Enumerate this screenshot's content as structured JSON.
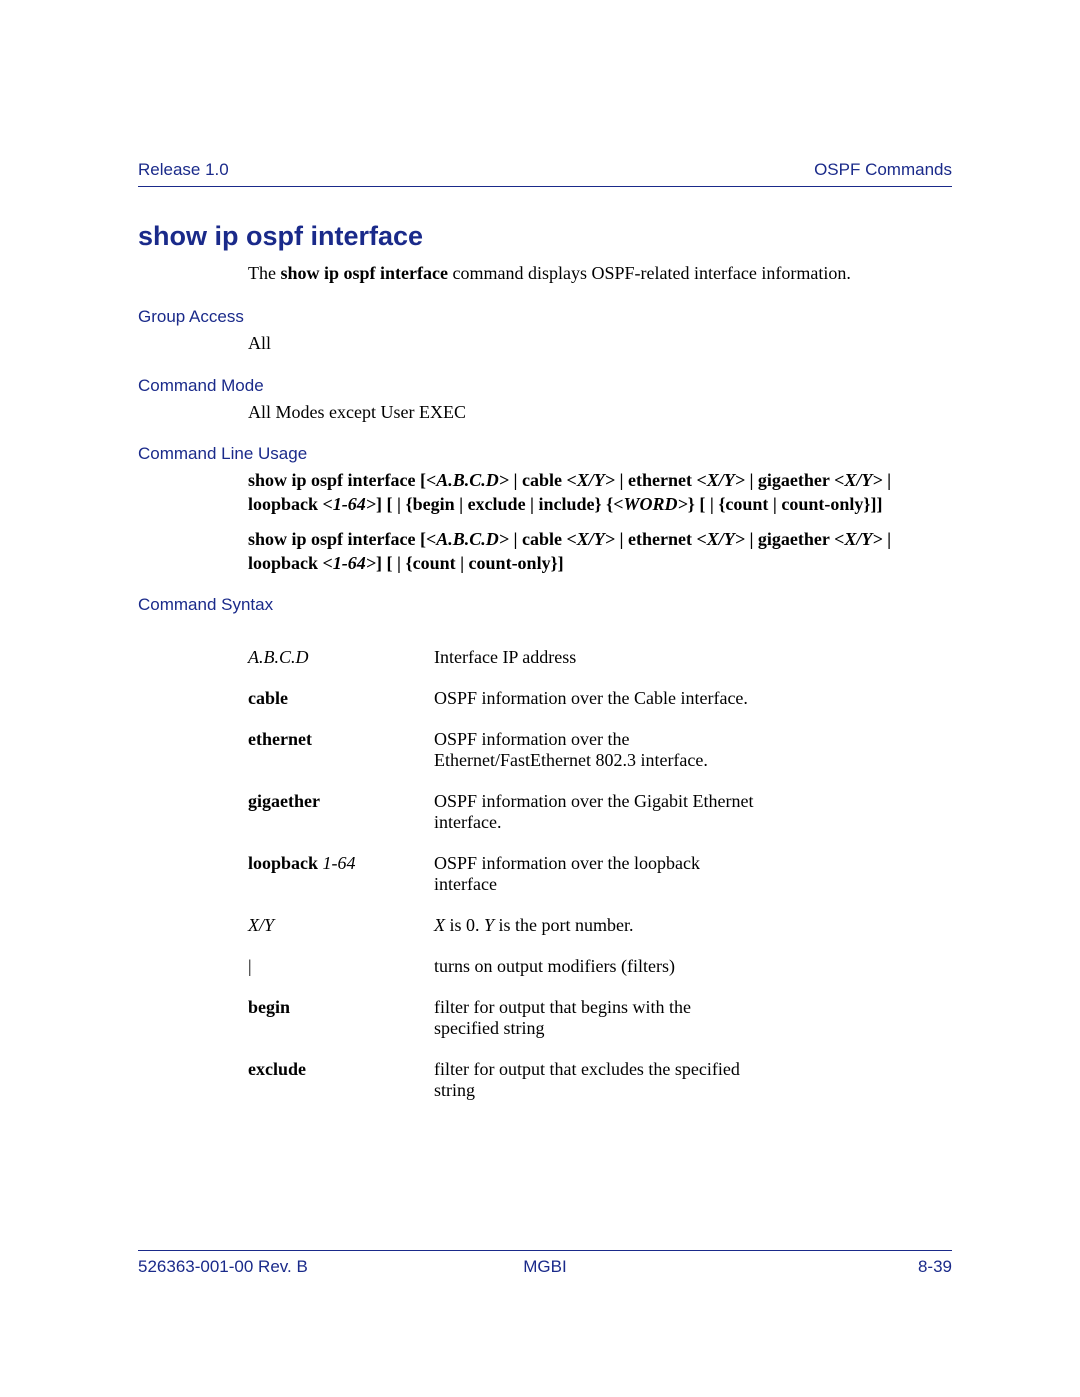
{
  "header": {
    "left": "Release 1.0",
    "right": "OSPF Commands"
  },
  "title": "show ip ospf interface",
  "intro": {
    "pre": "The ",
    "bold": "show ip ospf interface",
    "post": " command displays OSPF-related interface information."
  },
  "sections": {
    "group_access": {
      "label": "Group Access",
      "body": "All"
    },
    "command_mode": {
      "label": "Command Mode",
      "body": "All Modes except User EXEC"
    },
    "cli_usage": {
      "label": "Command Line Usage"
    },
    "command_syntax": {
      "label": "Command Syntax"
    }
  },
  "usage": {
    "line1": {
      "p1": "show ip ospf interface [",
      "i1": "<A.B.C.D>",
      "p2": " | cable ",
      "i2": "<X/Y>",
      "p3": " | ethernet ",
      "i3": "<X/Y>",
      "p4": " | gigaether ",
      "i4": "<X/Y>",
      "p5": " | loopback ",
      "i5": "<1-64>",
      "p6": "] [ | {begin | exclude | include} {",
      "i6": "<WORD>",
      "p7": "} [ | {count | count-only}]]"
    },
    "line2": {
      "p1": "show ip ospf interface [",
      "i1": "<A.B.C.D>",
      "p2": " | cable ",
      "i2": "<X/Y>",
      "p3": " | ethernet ",
      "i3": "<X/Y>",
      "p4": " | gigaether ",
      "i4": "<X/Y>",
      "p5": " | loopback ",
      "i5": "<1-64>",
      "p6": "]  [ | {count | count-only}]"
    }
  },
  "syntax": [
    {
      "term_italic": "A.B.C.D",
      "term_bold": "",
      "term_italic2": "",
      "def": "Interface IP address"
    },
    {
      "term_italic": "",
      "term_bold": "cable",
      "term_italic2": "",
      "def": "OSPF information over the Cable interface."
    },
    {
      "term_italic": "",
      "term_bold": "ethernet",
      "term_italic2": "",
      "def": "OSPF information over the Ethernet/FastEthernet 802.3 interface."
    },
    {
      "term_italic": "",
      "term_bold": "gigaether",
      "term_italic2": "",
      "def": "OSPF information over the Gigabit Ethernet interface."
    },
    {
      "term_italic": "",
      "term_bold": "loopback",
      "term_italic2": " 1-64",
      "def": "OSPF information over the loopback interface"
    },
    {
      "term_italic": "X/Y",
      "term_bold": "",
      "term_italic2": "",
      "def_pre": "",
      "def_i1": "X",
      "def_mid": " is 0. ",
      "def_i2": "Y",
      "def_post": " is the port number."
    },
    {
      "term_plain": "|",
      "def": "turns on output modifiers (filters)"
    },
    {
      "term_italic": "",
      "term_bold": "begin",
      "term_italic2": "",
      "def": "filter for output that begins with the specified string"
    },
    {
      "term_italic": "",
      "term_bold": "exclude",
      "term_italic2": "",
      "def": "filter for output that excludes the specified string"
    }
  ],
  "footer": {
    "left": "526363-001-00 Rev. B",
    "center": "MGBI",
    "right": "8-39"
  }
}
